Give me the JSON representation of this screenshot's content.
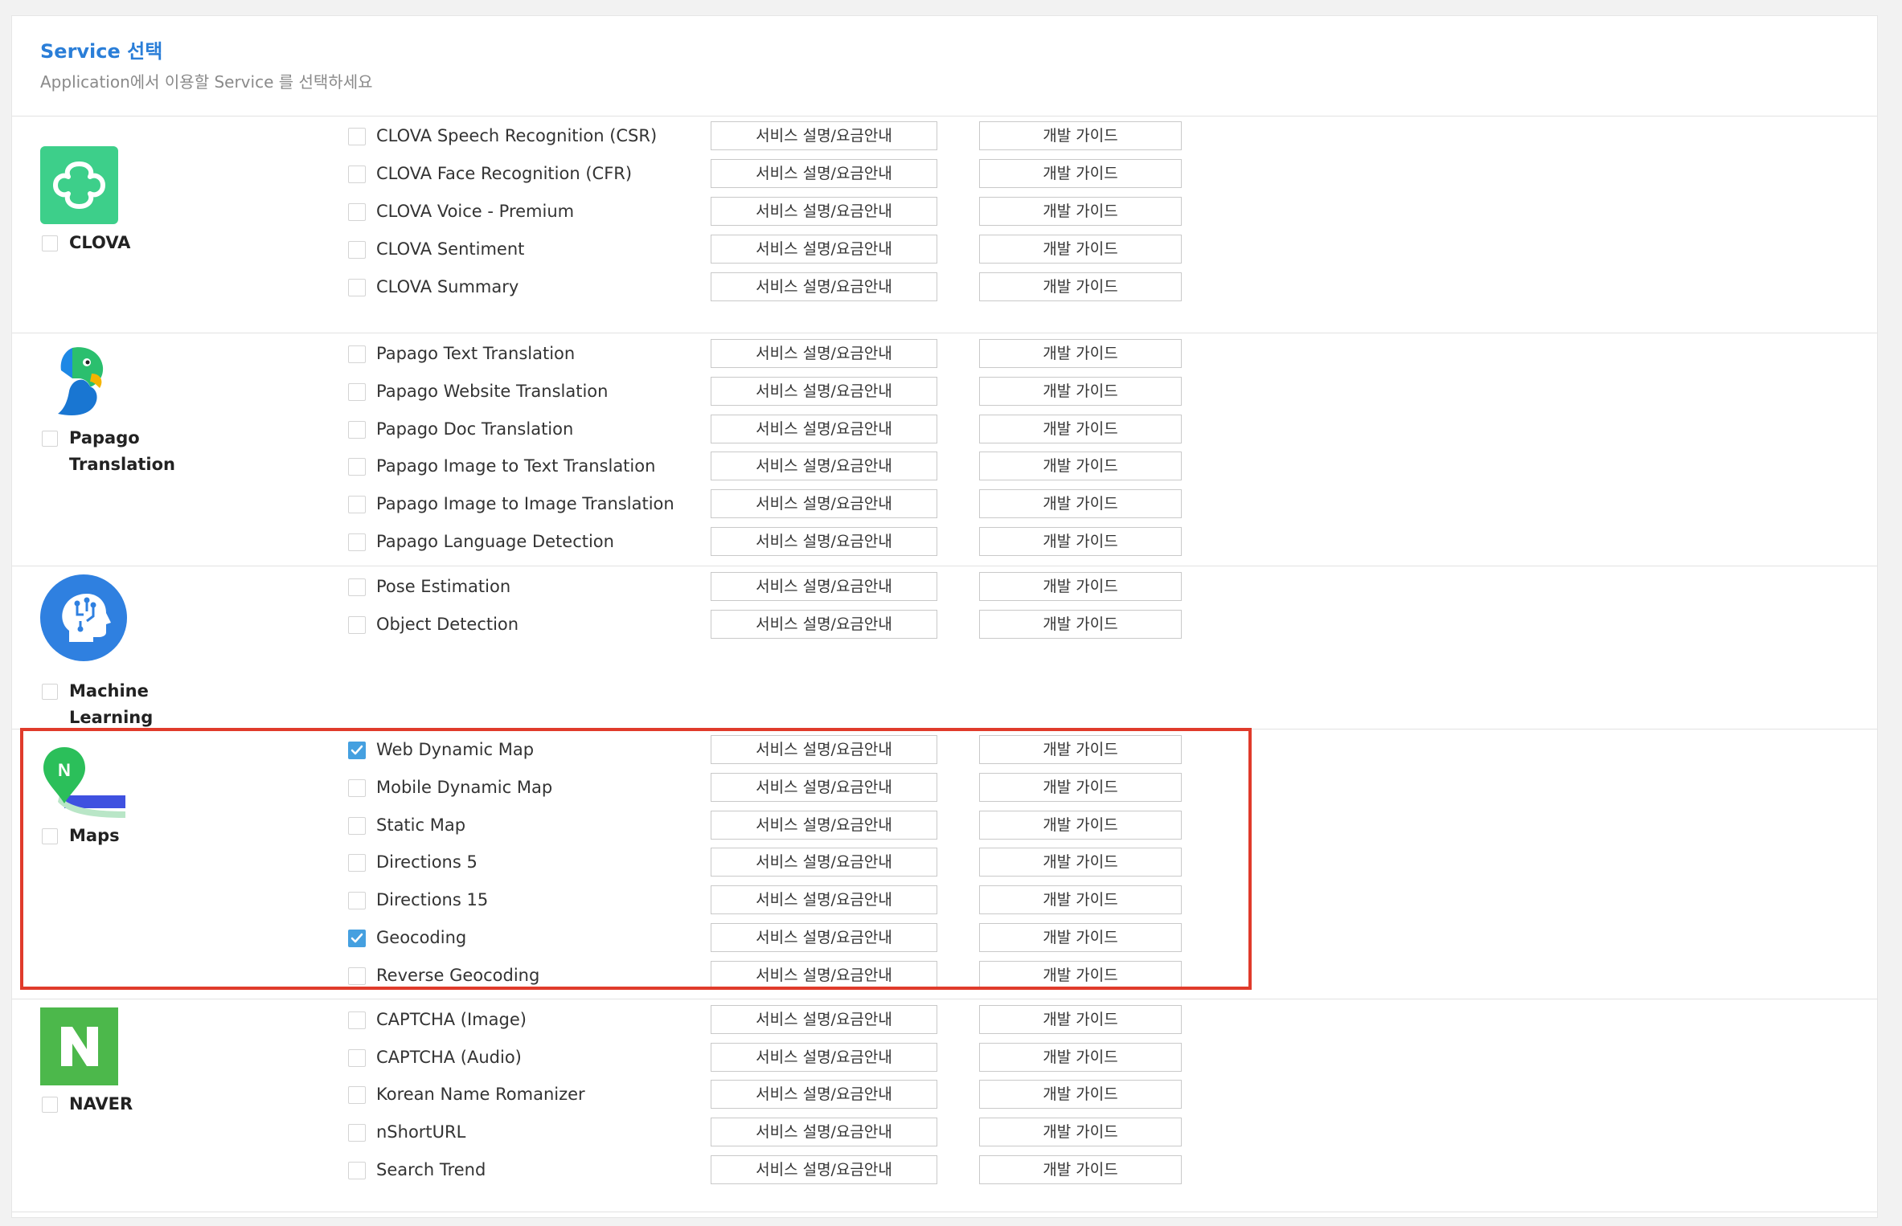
{
  "header": {
    "title": "Service 선택",
    "subtitle": "Application에서 이용할 Service 를 선택하세요"
  },
  "groups": [
    {
      "name": "CLOVA",
      "icon": "clova-icon",
      "items": [
        {
          "label": "CLOVA Speech Recognition (CSR)",
          "desc_btn": "서비스 설명/요금안내",
          "guide_btn": "개발 가이드",
          "checked": false
        },
        {
          "label": "CLOVA Face Recognition (CFR)",
          "desc_btn": "서비스 설명/요금안내",
          "guide_btn": "개발 가이드",
          "checked": false
        },
        {
          "label": "CLOVA Voice - Premium",
          "desc_btn": "서비스 설명/요금안내",
          "guide_btn": "개발 가이드",
          "checked": false
        },
        {
          "label": "CLOVA Sentiment",
          "desc_btn": "서비스 설명/요금안내",
          "guide_btn": "개발 가이드",
          "checked": false
        },
        {
          "label": "CLOVA Summary",
          "desc_btn": "서비스 설명/요금안내",
          "guide_btn": "개발 가이드",
          "checked": false
        }
      ]
    },
    {
      "name_line1": "Papago",
      "name_line2": "Translation",
      "icon": "papago-parrot-icon",
      "items": [
        {
          "label": "Papago Text Translation",
          "desc_btn": "서비스 설명/요금안내",
          "guide_btn": "개발 가이드",
          "checked": false
        },
        {
          "label": "Papago Website Translation",
          "desc_btn": "서비스 설명/요금안내",
          "guide_btn": "개발 가이드",
          "checked": false
        },
        {
          "label": "Papago Doc Translation",
          "desc_btn": "서비스 설명/요금안내",
          "guide_btn": "개발 가이드",
          "checked": false
        },
        {
          "label": "Papago Image to Text Translation",
          "desc_btn": "서비스 설명/요금안내",
          "guide_btn": "개발 가이드",
          "checked": false
        },
        {
          "label": "Papago Image to Image Translation",
          "desc_btn": "서비스 설명/요금안내",
          "guide_btn": "개발 가이드",
          "checked": false
        },
        {
          "label": "Papago Language Detection",
          "desc_btn": "서비스 설명/요금안내",
          "guide_btn": "개발 가이드",
          "checked": false
        }
      ]
    },
    {
      "name_line1": "Machine",
      "name_line2": "Learning",
      "icon": "machine-learning-head-icon",
      "items": [
        {
          "label": "Pose Estimation",
          "desc_btn": "서비스 설명/요금안내",
          "guide_btn": "개발 가이드",
          "checked": false
        },
        {
          "label": "Object Detection",
          "desc_btn": "서비스 설명/요금안내",
          "guide_btn": "개발 가이드",
          "checked": false
        }
      ]
    },
    {
      "name": "Maps",
      "icon": "maps-pin-icon",
      "items": [
        {
          "label": "Web Dynamic Map",
          "desc_btn": "서비스 설명/요금안내",
          "guide_btn": "개발 가이드",
          "checked": true
        },
        {
          "label": "Mobile Dynamic Map",
          "desc_btn": "서비스 설명/요금안내",
          "guide_btn": "개발 가이드",
          "checked": false
        },
        {
          "label": "Static Map",
          "desc_btn": "서비스 설명/요금안내",
          "guide_btn": "개발 가이드",
          "checked": false
        },
        {
          "label": "Directions 5",
          "desc_btn": "서비스 설명/요금안내",
          "guide_btn": "개발 가이드",
          "checked": false
        },
        {
          "label": "Directions 15",
          "desc_btn": "서비스 설명/요금안내",
          "guide_btn": "개발 가이드",
          "checked": false
        },
        {
          "label": "Geocoding",
          "desc_btn": "서비스 설명/요금안내",
          "guide_btn": "개발 가이드",
          "checked": true
        },
        {
          "label": "Reverse Geocoding",
          "desc_btn": "서비스 설명/요금안내",
          "guide_btn": "개발 가이드",
          "checked": false
        }
      ]
    },
    {
      "name": "NAVER",
      "icon": "naver-n-icon",
      "items": [
        {
          "label": "CAPTCHA (Image)",
          "desc_btn": "서비스 설명/요금안내",
          "guide_btn": "개발 가이드",
          "checked": false
        },
        {
          "label": "CAPTCHA (Audio)",
          "desc_btn": "서비스 설명/요금안내",
          "guide_btn": "개발 가이드",
          "checked": false
        },
        {
          "label": "Korean Name Romanizer",
          "desc_btn": "서비스 설명/요금안내",
          "guide_btn": "개발 가이드",
          "checked": false
        },
        {
          "label": "nShortURL",
          "desc_btn": "서비스 설명/요금안내",
          "guide_btn": "개발 가이드",
          "checked": false
        },
        {
          "label": "Search Trend",
          "desc_btn": "서비스 설명/요금안내",
          "guide_btn": "개발 가이드",
          "checked": false
        }
      ]
    }
  ],
  "colors": {
    "accent": "#2a7ed8",
    "checked": "#45a0e0",
    "highlight_border": "#e03b2b",
    "clova_green": "#3dcf8a",
    "naver_green": "#4cb84b"
  }
}
